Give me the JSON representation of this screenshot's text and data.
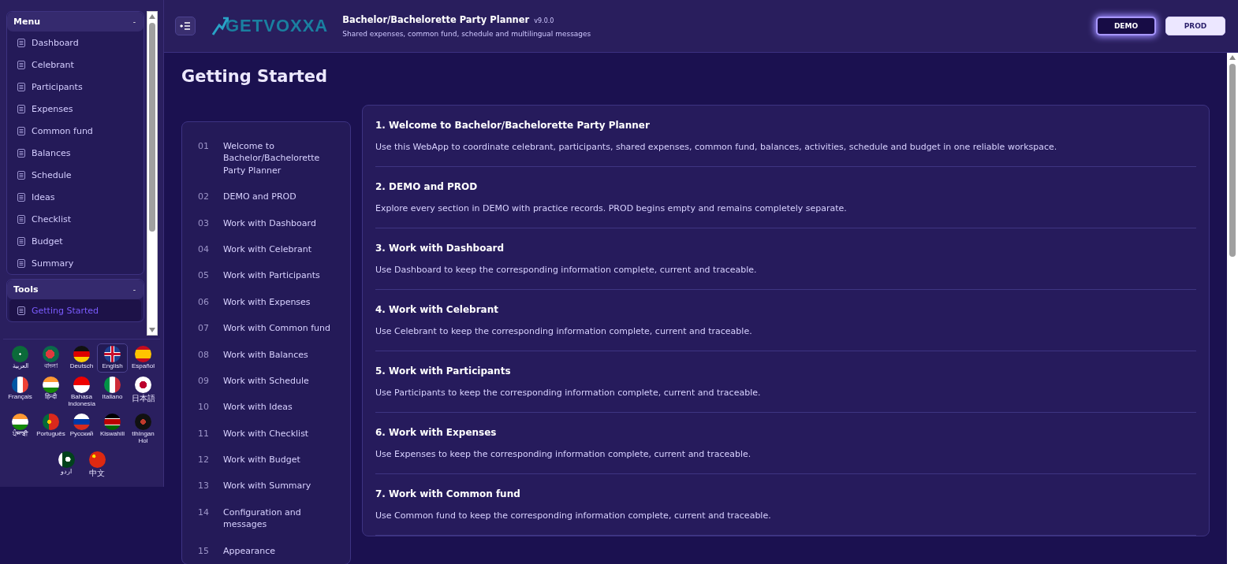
{
  "sidebar": {
    "sections": [
      {
        "title": "Menu",
        "toggle": "-",
        "items": [
          {
            "label": "Dashboard",
            "selected": false
          },
          {
            "label": "Celebrant",
            "selected": false
          },
          {
            "label": "Participants",
            "selected": false
          },
          {
            "label": "Expenses",
            "selected": false
          },
          {
            "label": "Common fund",
            "selected": false
          },
          {
            "label": "Balances",
            "selected": false
          },
          {
            "label": "Schedule",
            "selected": false
          },
          {
            "label": "Ideas",
            "selected": false
          },
          {
            "label": "Checklist",
            "selected": false
          },
          {
            "label": "Budget",
            "selected": false
          },
          {
            "label": "Summary",
            "selected": false
          }
        ]
      },
      {
        "title": "Tools",
        "toggle": "-",
        "items": [
          {
            "label": "Getting Started",
            "selected": true
          }
        ]
      }
    ],
    "languages": [
      {
        "label": "العربية",
        "selected": false
      },
      {
        "label": "বাংলা",
        "selected": false
      },
      {
        "label": "Deutsch",
        "selected": false
      },
      {
        "label": "English",
        "selected": true
      },
      {
        "label": "Español",
        "selected": false
      },
      {
        "label": "Français",
        "selected": false
      },
      {
        "label": "हिन्दी",
        "selected": false
      },
      {
        "label": "Bahasa Indonesia",
        "selected": false
      },
      {
        "label": "Italiano",
        "selected": false
      },
      {
        "label": "日本語",
        "selected": false
      },
      {
        "label": "ਪੰਜਾਬੀ",
        "selected": false
      },
      {
        "label": "Português",
        "selected": false
      },
      {
        "label": "Русский",
        "selected": false
      },
      {
        "label": "Kiswahili",
        "selected": false
      },
      {
        "label": "tlhIngan Hol",
        "selected": false
      },
      {
        "label": "اردو",
        "selected": false
      },
      {
        "label": "中文",
        "selected": false
      }
    ]
  },
  "header": {
    "logo": "GETVOXXA",
    "title": "Bachelor/Bachelorette Party Planner",
    "version": "v9.0.0",
    "subtitle": "Shared expenses, common fund, schedule and multilingual messages",
    "modes": [
      {
        "label": "DEMO",
        "selected": true
      },
      {
        "label": "PROD",
        "selected": false
      }
    ]
  },
  "page": {
    "title": "Getting Started",
    "toc": [
      {
        "number": "01",
        "label": "Welcome to Bachelor/Bachelorette Party Planner"
      },
      {
        "number": "02",
        "label": "DEMO and PROD"
      },
      {
        "number": "03",
        "label": "Work with Dashboard"
      },
      {
        "number": "04",
        "label": "Work with Celebrant"
      },
      {
        "number": "05",
        "label": "Work with Participants"
      },
      {
        "number": "06",
        "label": "Work with Expenses"
      },
      {
        "number": "07",
        "label": "Work with Common fund"
      },
      {
        "number": "08",
        "label": "Work with Balances"
      },
      {
        "number": "09",
        "label": "Work with Schedule"
      },
      {
        "number": "10",
        "label": "Work with Ideas"
      },
      {
        "number": "11",
        "label": "Work with Checklist"
      },
      {
        "number": "12",
        "label": "Work with Budget"
      },
      {
        "number": "13",
        "label": "Work with Summary"
      },
      {
        "number": "14",
        "label": "Configuration and messages"
      },
      {
        "number": "15",
        "label": "Appearance"
      }
    ],
    "sections": [
      {
        "heading": "1. Welcome to Bachelor/Bachelorette Party Planner",
        "text": "Use this WebApp to coordinate celebrant, participants, shared expenses, common fund, balances, activities, schedule and budget in one reliable workspace."
      },
      {
        "heading": "2. DEMO and PROD",
        "text": "Explore every section in DEMO with practice records. PROD begins empty and remains completely separate."
      },
      {
        "heading": "3. Work with Dashboard",
        "text": "Use Dashboard to keep the corresponding information complete, current and traceable."
      },
      {
        "heading": "4. Work with Celebrant",
        "text": "Use Celebrant to keep the corresponding information complete, current and traceable."
      },
      {
        "heading": "5. Work with Participants",
        "text": "Use Participants to keep the corresponding information complete, current and traceable."
      },
      {
        "heading": "6. Work with Expenses",
        "text": "Use Expenses to keep the corresponding information complete, current and traceable."
      },
      {
        "heading": "7. Work with Common fund",
        "text": "Use Common fund to keep the corresponding information complete, current and traceable."
      }
    ]
  }
}
